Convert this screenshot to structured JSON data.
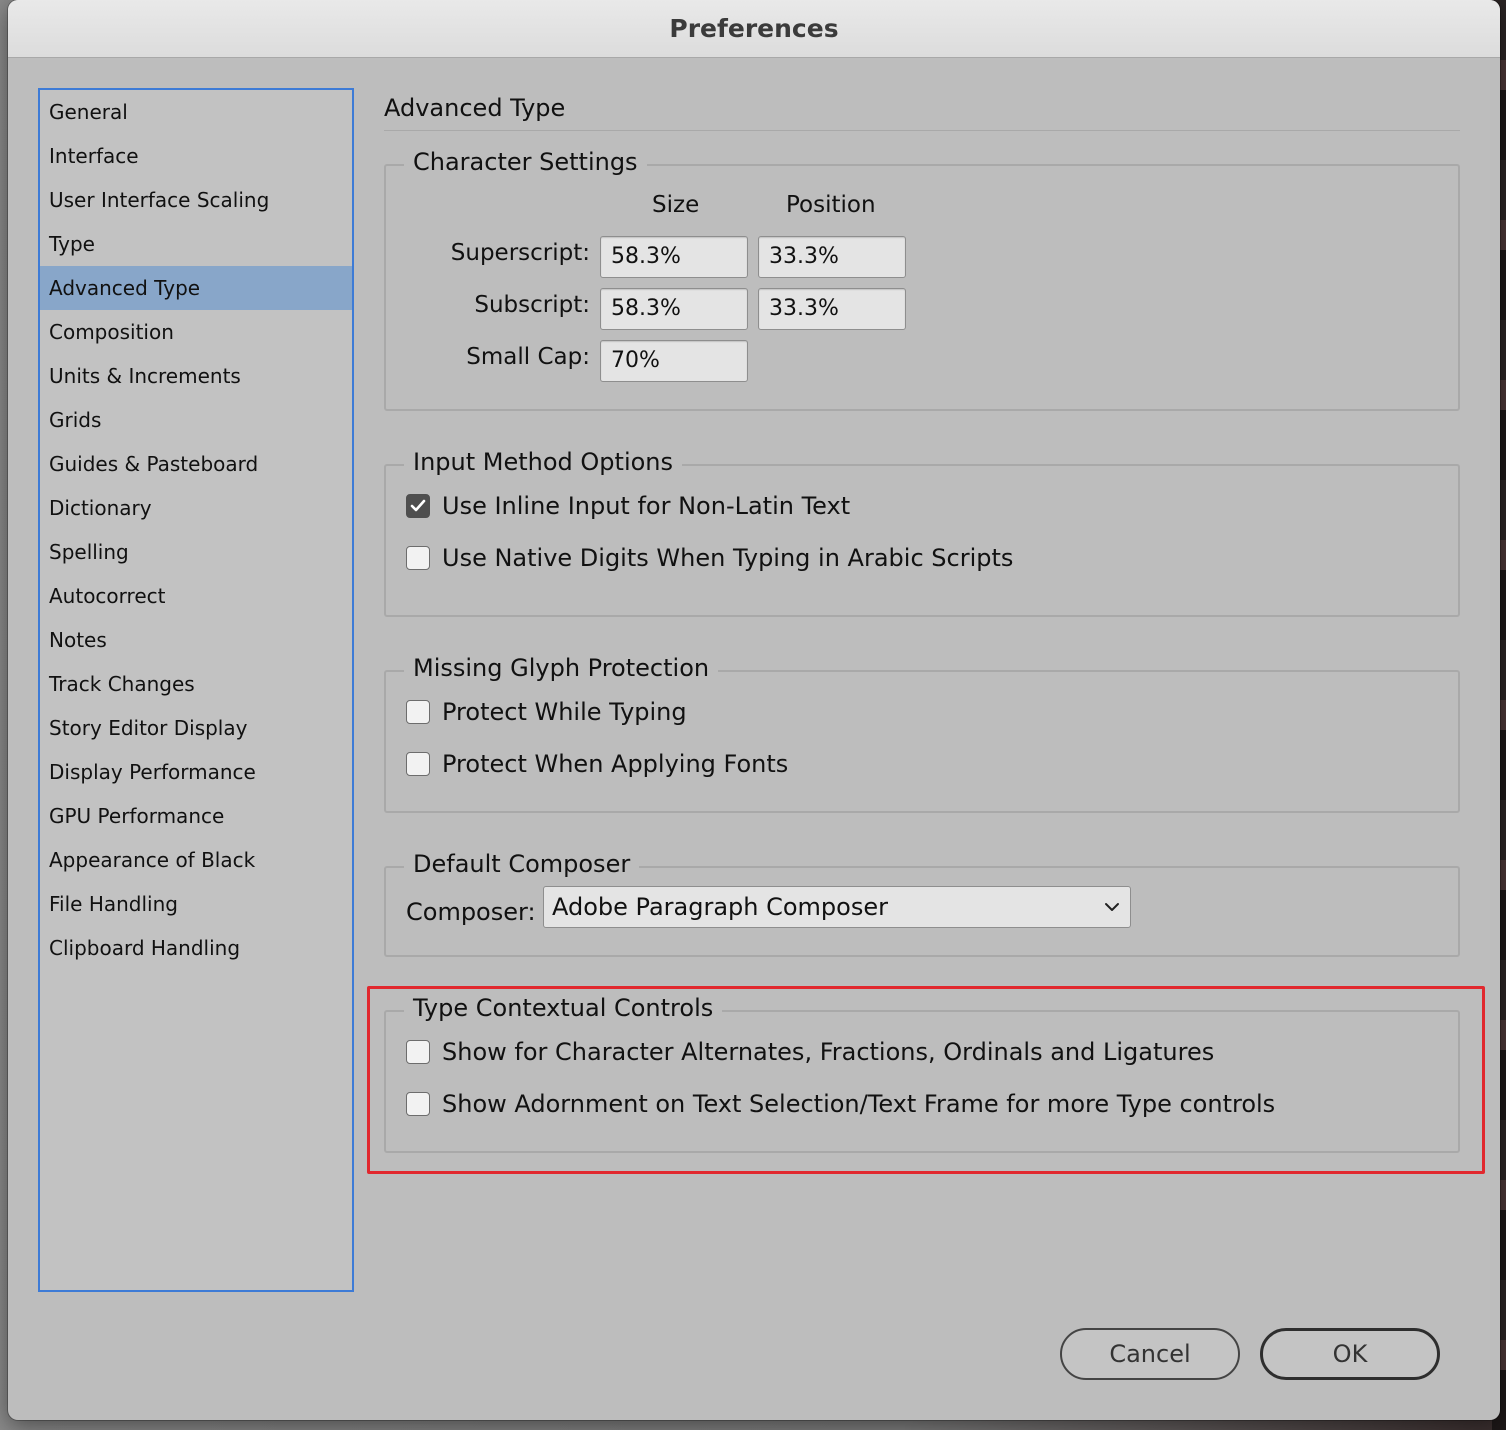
{
  "window": {
    "title": "Preferences"
  },
  "sidebar": {
    "selected_index": 4,
    "items": [
      {
        "label": "General"
      },
      {
        "label": "Interface"
      },
      {
        "label": "User Interface Scaling"
      },
      {
        "label": "Type"
      },
      {
        "label": "Advanced Type"
      },
      {
        "label": "Composition"
      },
      {
        "label": "Units & Increments"
      },
      {
        "label": "Grids"
      },
      {
        "label": "Guides & Pasteboard"
      },
      {
        "label": "Dictionary"
      },
      {
        "label": "Spelling"
      },
      {
        "label": "Autocorrect"
      },
      {
        "label": "Notes"
      },
      {
        "label": "Track Changes"
      },
      {
        "label": "Story Editor Display"
      },
      {
        "label": "Display Performance"
      },
      {
        "label": "GPU Performance"
      },
      {
        "label": "Appearance of Black"
      },
      {
        "label": "File Handling"
      },
      {
        "label": "Clipboard Handling"
      }
    ]
  },
  "main": {
    "page_title": "Advanced Type",
    "character_settings": {
      "label": "Character Settings",
      "col_size": "Size",
      "col_position": "Position",
      "superscript": {
        "label": "Superscript:",
        "size": "58.3%",
        "position": "33.3%"
      },
      "subscript": {
        "label": "Subscript:",
        "size": "58.3%",
        "position": "33.3%"
      },
      "small_cap": {
        "label": "Small Cap:",
        "size": "70%"
      }
    },
    "input_method": {
      "label": "Input Method Options",
      "inline_input": {
        "label": "Use Inline Input for Non-Latin Text",
        "checked": true
      },
      "native_digits": {
        "label": "Use Native Digits When Typing in Arabic Scripts",
        "checked": false
      }
    },
    "missing_glyph": {
      "label": "Missing Glyph Protection",
      "while_typing": {
        "label": "Protect While Typing",
        "checked": false
      },
      "applying_fonts": {
        "label": "Protect When Applying Fonts",
        "checked": false
      }
    },
    "default_composer": {
      "label": "Default Composer",
      "composer_label": "Composer:",
      "composer_value": "Adobe Paragraph Composer"
    },
    "type_contextual": {
      "label": "Type Contextual Controls",
      "show_alternates": {
        "label": "Show for Character Alternates, Fractions, Ordinals and Ligatures",
        "checked": false
      },
      "show_adornment": {
        "label": "Show Adornment on Text Selection/Text Frame for more Type controls",
        "checked": false
      },
      "highlight_color": "#e1282e"
    }
  },
  "footer": {
    "cancel_label": "Cancel",
    "ok_label": "OK"
  },
  "colors": {
    "dialog_bg": "#bdbdbd",
    "sidebar_selected": "#88a6c9",
    "sidebar_focus_border": "#3d7bd6"
  }
}
